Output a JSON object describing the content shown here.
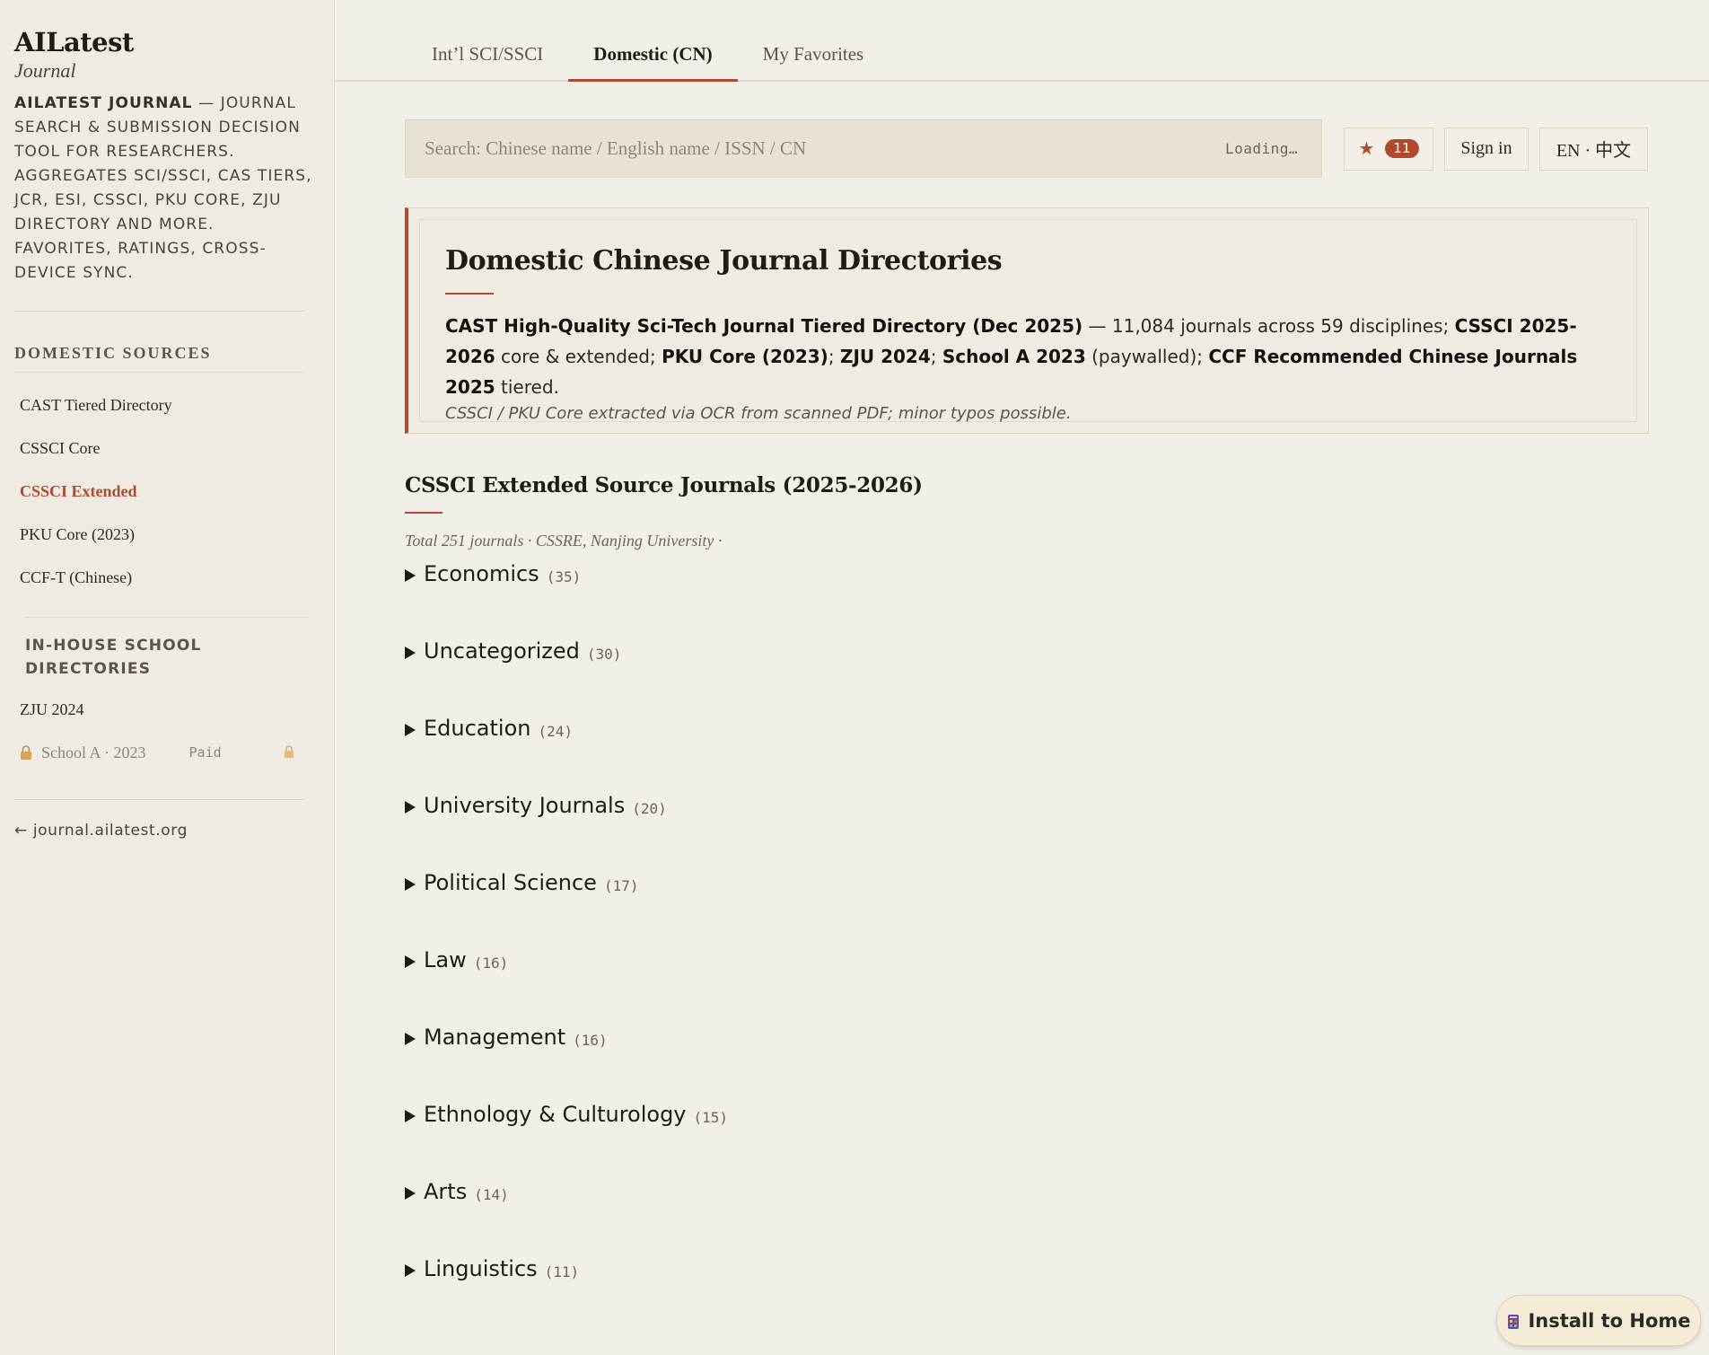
{
  "sidebar": {
    "logo_title": "AILatest",
    "logo_sub": "Journal",
    "intro_brand": "AILatest Journal",
    "intro_text": " — Journal search & submission decision tool for researchers. Aggregates SCI/SSCI, CAS tiers, JCR, ESI, CSSCI, PKU Core, ZJU Directory and more. Favorites, ratings, cross-device sync.",
    "domestic_title": "Domestic Sources",
    "domestic_items": [
      {
        "label": "CAST Tiered Directory"
      },
      {
        "label": "CSSCI Core"
      },
      {
        "label": "CSSCI Extended"
      },
      {
        "label": "PKU Core (2023)"
      },
      {
        "label": "CCF-T (Chinese)"
      }
    ],
    "school_title": "In-house School Directories",
    "school_items": [
      {
        "label": "ZJU 2024"
      }
    ],
    "locked_item": {
      "label": "School A · 2023",
      "tag": "Paid"
    },
    "site_link": "← journal.ailatest.org"
  },
  "tabs": [
    {
      "label": "Int’l SCI/SSCI"
    },
    {
      "label": "Domestic (CN)"
    },
    {
      "label": "My Favorites"
    }
  ],
  "search": {
    "placeholder": "Search: Chinese name / English name / ISSN / CN",
    "status": "Loading…"
  },
  "toolbar": {
    "fav_star": "★",
    "fav_count": "11",
    "signin": "Sign in",
    "lang": "EN · 中文"
  },
  "panel": {
    "title": "Domestic Chinese Journal Directories",
    "p1_b": "CAST High-Quality Sci-Tech Journal Tiered Directory (Dec 2025)",
    "p1_t": " — 11,084 journals across 59 disciplines; ",
    "p2_b": "CSSCI 2025-2026",
    "p2_t": " core & extended; ",
    "p3_b": "PKU Core (2023)",
    "p3_t": "; ",
    "p4_b": "ZJU 2024",
    "p4_t": "; ",
    "p5_b": "School A 2023",
    "p5_t": " (paywalled); ",
    "p6_b": "CCF Recommended Chinese Journals 2025",
    "p6_t": " tiered.",
    "note": "CSSCI / PKU Core extracted via OCR from scanned PDF; minor typos possible."
  },
  "section": {
    "title": "CSSCI Extended Source Journals (2025-2026)",
    "meta": "Total 251 journals · CSSRE, Nanjing University ·",
    "categories": [
      {
        "name": "Economics",
        "count": "(35)"
      },
      {
        "name": "Uncategorized",
        "count": "(30)"
      },
      {
        "name": "Education",
        "count": "(24)"
      },
      {
        "name": "University Journals",
        "count": "(20)"
      },
      {
        "name": "Political Science",
        "count": "(17)"
      },
      {
        "name": "Law",
        "count": "(16)"
      },
      {
        "name": "Management",
        "count": "(16)"
      },
      {
        "name": "Ethnology & Culturology",
        "count": "(15)"
      },
      {
        "name": "Arts",
        "count": "(14)"
      },
      {
        "name": "Linguistics",
        "count": "(11)"
      }
    ]
  },
  "install": {
    "label": "Install to Home"
  },
  "colors": {
    "accent": "#b04a2e",
    "background": "#f2efe8",
    "sidebar": "#efebe3"
  }
}
